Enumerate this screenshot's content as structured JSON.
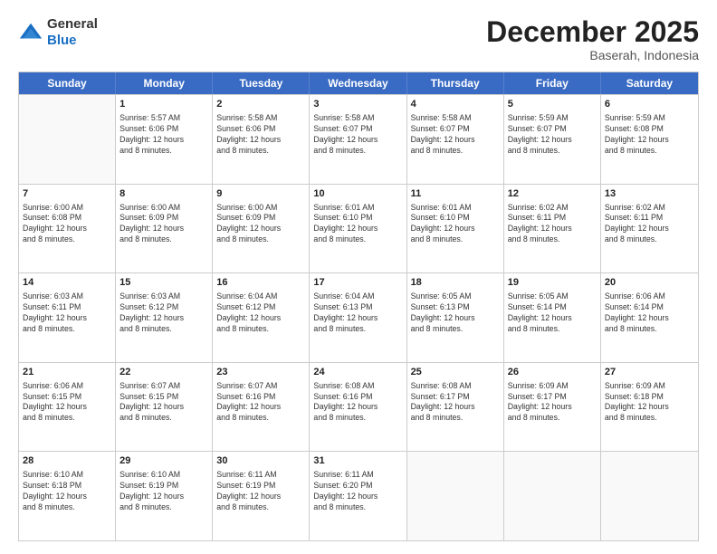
{
  "logo": {
    "general": "General",
    "blue": "Blue"
  },
  "header": {
    "month": "December 2025",
    "location": "Baserah, Indonesia"
  },
  "days": [
    "Sunday",
    "Monday",
    "Tuesday",
    "Wednesday",
    "Thursday",
    "Friday",
    "Saturday"
  ],
  "rows": [
    [
      {
        "day": "",
        "empty": true
      },
      {
        "day": "1",
        "sunrise": "5:57 AM",
        "sunset": "6:06 PM",
        "daylight": "12 hours and 8 minutes."
      },
      {
        "day": "2",
        "sunrise": "5:58 AM",
        "sunset": "6:06 PM",
        "daylight": "12 hours and 8 minutes."
      },
      {
        "day": "3",
        "sunrise": "5:58 AM",
        "sunset": "6:07 PM",
        "daylight": "12 hours and 8 minutes."
      },
      {
        "day": "4",
        "sunrise": "5:58 AM",
        "sunset": "6:07 PM",
        "daylight": "12 hours and 8 minutes."
      },
      {
        "day": "5",
        "sunrise": "5:59 AM",
        "sunset": "6:07 PM",
        "daylight": "12 hours and 8 minutes."
      },
      {
        "day": "6",
        "sunrise": "5:59 AM",
        "sunset": "6:08 PM",
        "daylight": "12 hours and 8 minutes."
      }
    ],
    [
      {
        "day": "7",
        "sunrise": "6:00 AM",
        "sunset": "6:08 PM",
        "daylight": "12 hours and 8 minutes."
      },
      {
        "day": "8",
        "sunrise": "6:00 AM",
        "sunset": "6:09 PM",
        "daylight": "12 hours and 8 minutes."
      },
      {
        "day": "9",
        "sunrise": "6:00 AM",
        "sunset": "6:09 PM",
        "daylight": "12 hours and 8 minutes."
      },
      {
        "day": "10",
        "sunrise": "6:01 AM",
        "sunset": "6:10 PM",
        "daylight": "12 hours and 8 minutes."
      },
      {
        "day": "11",
        "sunrise": "6:01 AM",
        "sunset": "6:10 PM",
        "daylight": "12 hours and 8 minutes."
      },
      {
        "day": "12",
        "sunrise": "6:02 AM",
        "sunset": "6:11 PM",
        "daylight": "12 hours and 8 minutes."
      },
      {
        "day": "13",
        "sunrise": "6:02 AM",
        "sunset": "6:11 PM",
        "daylight": "12 hours and 8 minutes."
      }
    ],
    [
      {
        "day": "14",
        "sunrise": "6:03 AM",
        "sunset": "6:11 PM",
        "daylight": "12 hours and 8 minutes."
      },
      {
        "day": "15",
        "sunrise": "6:03 AM",
        "sunset": "6:12 PM",
        "daylight": "12 hours and 8 minutes."
      },
      {
        "day": "16",
        "sunrise": "6:04 AM",
        "sunset": "6:12 PM",
        "daylight": "12 hours and 8 minutes."
      },
      {
        "day": "17",
        "sunrise": "6:04 AM",
        "sunset": "6:13 PM",
        "daylight": "12 hours and 8 minutes."
      },
      {
        "day": "18",
        "sunrise": "6:05 AM",
        "sunset": "6:13 PM",
        "daylight": "12 hours and 8 minutes."
      },
      {
        "day": "19",
        "sunrise": "6:05 AM",
        "sunset": "6:14 PM",
        "daylight": "12 hours and 8 minutes."
      },
      {
        "day": "20",
        "sunrise": "6:06 AM",
        "sunset": "6:14 PM",
        "daylight": "12 hours and 8 minutes."
      }
    ],
    [
      {
        "day": "21",
        "sunrise": "6:06 AM",
        "sunset": "6:15 PM",
        "daylight": "12 hours and 8 minutes."
      },
      {
        "day": "22",
        "sunrise": "6:07 AM",
        "sunset": "6:15 PM",
        "daylight": "12 hours and 8 minutes."
      },
      {
        "day": "23",
        "sunrise": "6:07 AM",
        "sunset": "6:16 PM",
        "daylight": "12 hours and 8 minutes."
      },
      {
        "day": "24",
        "sunrise": "6:08 AM",
        "sunset": "6:16 PM",
        "daylight": "12 hours and 8 minutes."
      },
      {
        "day": "25",
        "sunrise": "6:08 AM",
        "sunset": "6:17 PM",
        "daylight": "12 hours and 8 minutes."
      },
      {
        "day": "26",
        "sunrise": "6:09 AM",
        "sunset": "6:17 PM",
        "daylight": "12 hours and 8 minutes."
      },
      {
        "day": "27",
        "sunrise": "6:09 AM",
        "sunset": "6:18 PM",
        "daylight": "12 hours and 8 minutes."
      }
    ],
    [
      {
        "day": "28",
        "sunrise": "6:10 AM",
        "sunset": "6:18 PM",
        "daylight": "12 hours and 8 minutes."
      },
      {
        "day": "29",
        "sunrise": "6:10 AM",
        "sunset": "6:19 PM",
        "daylight": "12 hours and 8 minutes."
      },
      {
        "day": "30",
        "sunrise": "6:11 AM",
        "sunset": "6:19 PM",
        "daylight": "12 hours and 8 minutes."
      },
      {
        "day": "31",
        "sunrise": "6:11 AM",
        "sunset": "6:20 PM",
        "daylight": "12 hours and 8 minutes."
      },
      {
        "day": "",
        "empty": true
      },
      {
        "day": "",
        "empty": true
      },
      {
        "day": "",
        "empty": true
      }
    ]
  ],
  "labels": {
    "sunrise_prefix": "Sunrise: ",
    "sunset_prefix": "Sunset: ",
    "daylight_label": "Daylight: "
  }
}
